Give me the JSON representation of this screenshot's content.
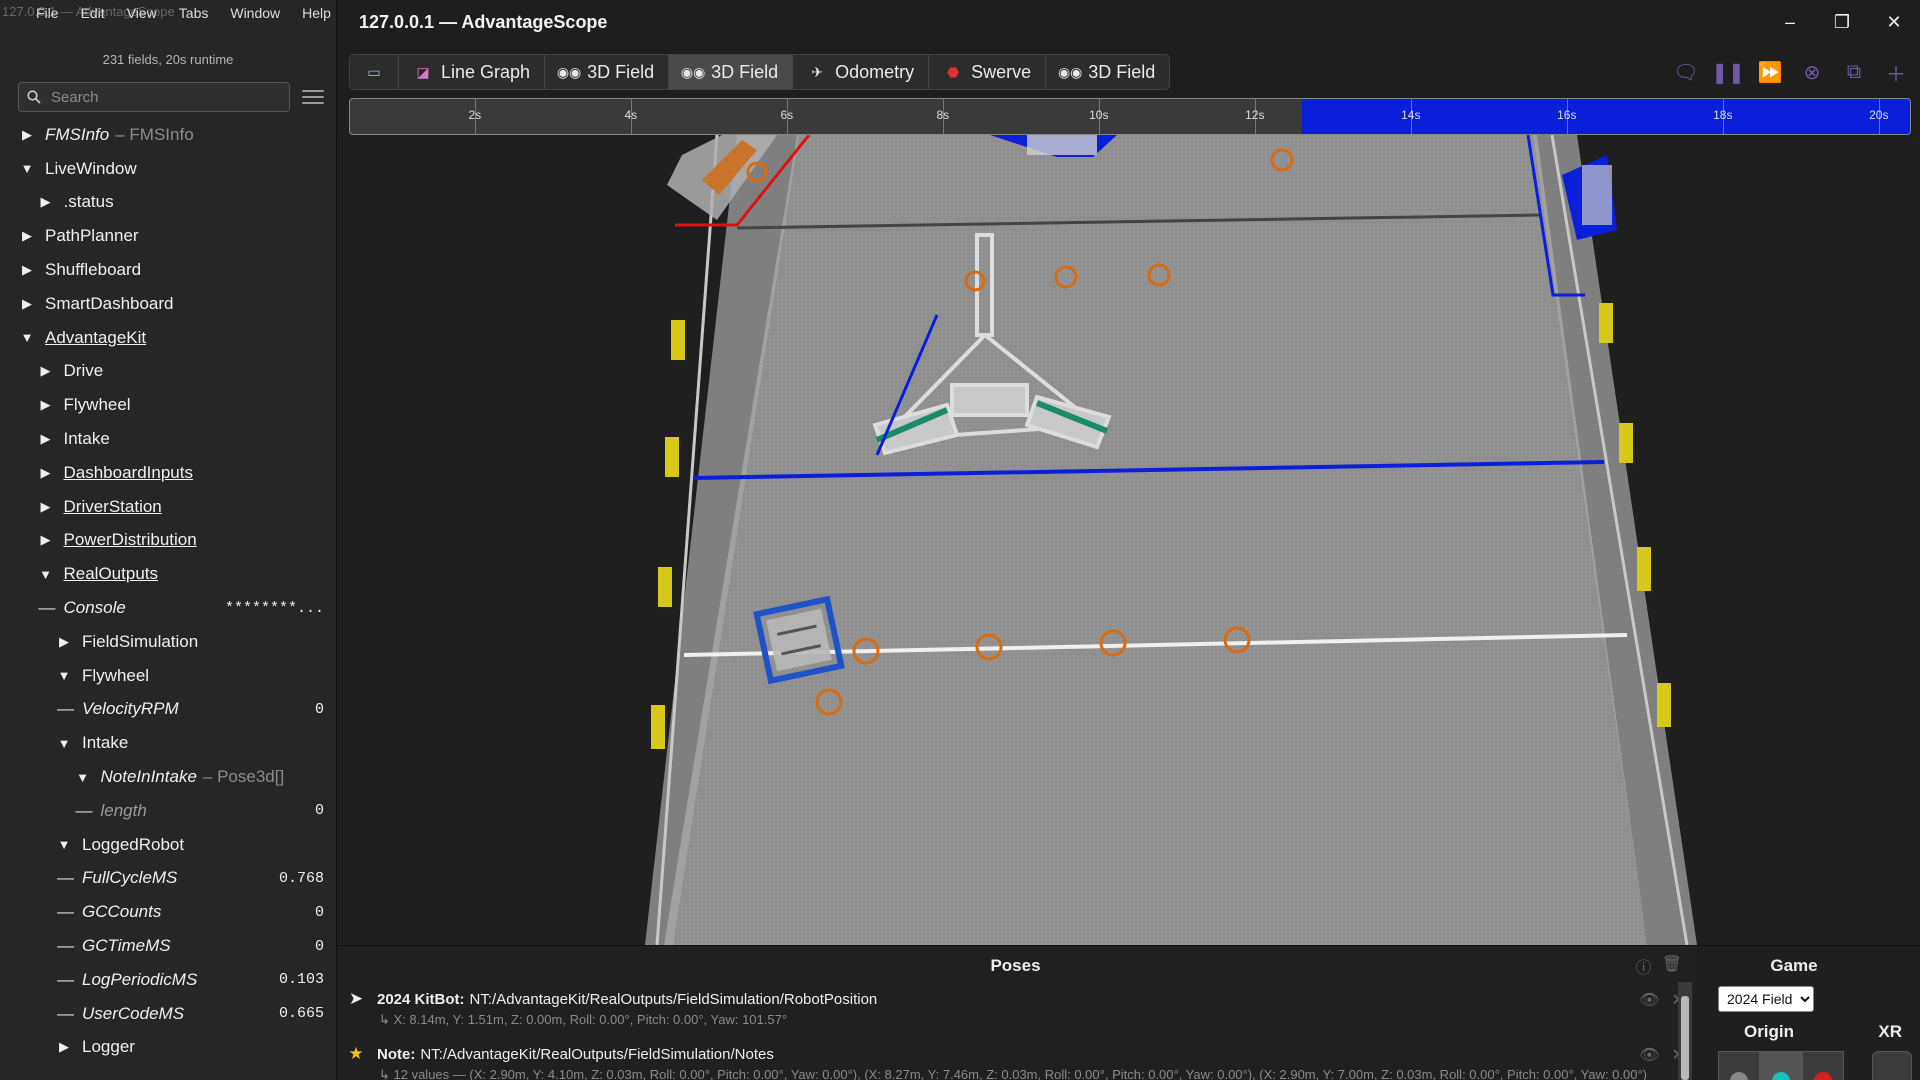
{
  "app": {
    "window_title": "127.0.0.1 — AdvantageScope",
    "ghost_title": "127.0.0.1 — AdvantageScope",
    "menu": [
      "File",
      "Edit",
      "View",
      "Tabs",
      "Window",
      "Help"
    ]
  },
  "sidebar": {
    "fields_info": "231 fields, 20s runtime",
    "search_placeholder": "Search",
    "tree": [
      {
        "indent": 0,
        "toggle": "collapsed",
        "label": "FMSInfo",
        "italic": true,
        "underline": false,
        "type": "– FMSInfo",
        "value": ""
      },
      {
        "indent": 0,
        "toggle": "expanded",
        "label": "LiveWindow",
        "italic": false,
        "underline": false,
        "type": "",
        "value": ""
      },
      {
        "indent": 1,
        "toggle": "collapsed",
        "label": ".status",
        "italic": false,
        "underline": false,
        "type": "",
        "value": ""
      },
      {
        "indent": 0,
        "toggle": "collapsed",
        "label": "PathPlanner",
        "italic": false,
        "underline": false,
        "type": "",
        "value": ""
      },
      {
        "indent": 0,
        "toggle": "collapsed",
        "label": "Shuffleboard",
        "italic": false,
        "underline": false,
        "type": "",
        "value": ""
      },
      {
        "indent": 0,
        "toggle": "collapsed",
        "label": "SmartDashboard",
        "italic": false,
        "underline": false,
        "type": "",
        "value": ""
      },
      {
        "indent": 0,
        "toggle": "expanded",
        "label": "AdvantageKit",
        "italic": false,
        "underline": true,
        "type": "",
        "value": ""
      },
      {
        "indent": 1,
        "toggle": "collapsed",
        "label": "Drive",
        "italic": false,
        "underline": false,
        "type": "",
        "value": ""
      },
      {
        "indent": 1,
        "toggle": "collapsed",
        "label": "Flywheel",
        "italic": false,
        "underline": false,
        "type": "",
        "value": ""
      },
      {
        "indent": 1,
        "toggle": "collapsed",
        "label": "Intake",
        "italic": false,
        "underline": false,
        "type": "",
        "value": ""
      },
      {
        "indent": 1,
        "toggle": "collapsed",
        "label": "DashboardInputs",
        "italic": false,
        "underline": true,
        "type": "",
        "value": ""
      },
      {
        "indent": 1,
        "toggle": "collapsed",
        "label": "DriverStation",
        "italic": false,
        "underline": true,
        "type": "",
        "value": ""
      },
      {
        "indent": 1,
        "toggle": "collapsed",
        "label": "PowerDistribution",
        "italic": false,
        "underline": true,
        "type": "",
        "value": ""
      },
      {
        "indent": 1,
        "toggle": "expanded",
        "label": "RealOutputs",
        "italic": false,
        "underline": true,
        "type": "",
        "value": ""
      },
      {
        "indent": 1,
        "toggle": "leaf",
        "label": "Console",
        "italic": true,
        "underline": false,
        "type": "",
        "value": "********..."
      },
      {
        "indent": 2,
        "toggle": "collapsed",
        "label": "FieldSimulation",
        "italic": false,
        "underline": false,
        "type": "",
        "value": ""
      },
      {
        "indent": 2,
        "toggle": "expanded",
        "label": "Flywheel",
        "italic": false,
        "underline": false,
        "type": "",
        "value": ""
      },
      {
        "indent": 2,
        "toggle": "leaf",
        "label": "VelocityRPM",
        "italic": true,
        "underline": false,
        "type": "",
        "value": "0"
      },
      {
        "indent": 2,
        "toggle": "expanded",
        "label": "Intake",
        "italic": false,
        "underline": false,
        "type": "",
        "value": ""
      },
      {
        "indent": 3,
        "toggle": "expanded",
        "label": "NoteInIntake",
        "italic": true,
        "underline": false,
        "type": "– Pose3d[]",
        "value": ""
      },
      {
        "indent": 3,
        "toggle": "leaf",
        "label": "length",
        "italic": true,
        "underline": false,
        "type": "",
        "value": "0",
        "dim": true
      },
      {
        "indent": 2,
        "toggle": "expanded",
        "label": "LoggedRobot",
        "italic": false,
        "underline": false,
        "type": "",
        "value": ""
      },
      {
        "indent": 2,
        "toggle": "leaf",
        "label": "FullCycleMS",
        "italic": true,
        "underline": false,
        "type": "",
        "value": "0.768"
      },
      {
        "indent": 2,
        "toggle": "leaf",
        "label": "GCCounts",
        "italic": true,
        "underline": false,
        "type": "",
        "value": "0"
      },
      {
        "indent": 2,
        "toggle": "leaf",
        "label": "GCTimeMS",
        "italic": true,
        "underline": false,
        "type": "",
        "value": "0"
      },
      {
        "indent": 2,
        "toggle": "leaf",
        "label": "LogPeriodicMS",
        "italic": true,
        "underline": false,
        "type": "",
        "value": "0.103"
      },
      {
        "indent": 2,
        "toggle": "leaf",
        "label": "UserCodeMS",
        "italic": true,
        "underline": false,
        "type": "",
        "value": "0.665"
      },
      {
        "indent": 2,
        "toggle": "collapsed",
        "label": "Logger",
        "italic": false,
        "underline": false,
        "type": "",
        "value": ""
      }
    ]
  },
  "tabs": [
    {
      "label": "",
      "icon": "document-icon",
      "active": false
    },
    {
      "label": "Line Graph",
      "icon": "line-graph-icon",
      "active": false
    },
    {
      "label": "3D Field",
      "icon": "3d-field-icon",
      "active": false
    },
    {
      "label": "3D Field",
      "icon": "3d-field-icon",
      "active": true
    },
    {
      "label": "Odometry",
      "icon": "odometry-icon",
      "active": false
    },
    {
      "label": "Swerve",
      "icon": "swerve-icon",
      "active": false
    },
    {
      "label": "3D Field",
      "icon": "3d-field-icon",
      "active": false
    }
  ],
  "timeline": {
    "range": [
      0.4,
      20.4
    ],
    "ticks": [
      "2s",
      "4s",
      "6s",
      "8s",
      "10s",
      "12s",
      "14s",
      "16s",
      "18s",
      "20s"
    ],
    "tick_values": [
      2,
      4,
      6,
      8,
      10,
      12,
      14,
      16,
      18,
      20
    ],
    "selection_start": 12.6,
    "selection_end": 20.4,
    "selection_color": "#0a1fd9"
  },
  "poses": {
    "title": "Poses",
    "items": [
      {
        "icon": "navigation-arrow-icon",
        "name": "2024 KitBot:",
        "path": "NT:/AdvantageKit/RealOutputs/FieldSimulation/RobotPosition",
        "detail": "↳ X: 8.14m, Y: 1.51m, Z: 0.00m, Roll: 0.00°, Pitch: 0.00°, Yaw: 101.57°"
      },
      {
        "icon": "star-icon",
        "name": "Note:",
        "path": "NT:/AdvantageKit/RealOutputs/FieldSimulation/Notes",
        "detail": "↳ 12 values — (X: 2.90m, Y: 4.10m, Z: 0.03m, Roll: 0.00°, Pitch: 0.00°, Yaw: 0.00°), (X: 8.27m, Y: 7.46m, Z: 0.03m, Roll: 0.00°, Pitch: 0.00°, Yaw: 0.00°), (X: 2.90m, Y: 7.00m, Z: 0.03m, Roll: 0.00°, Pitch: 0.00°, Yaw: 0.00°)"
      }
    ]
  },
  "config": {
    "game_label": "Game",
    "game_selected": "2024 Field",
    "origin_label": "Origin",
    "xr_label": "XR",
    "origin_colors": [
      "#888888",
      "#18c0c0",
      "#d42020"
    ]
  },
  "colors": {
    "blue_alliance": "#0a1fd9",
    "red_alliance": "#e01010",
    "note": "#d86a10",
    "accent": "#6e5ba8"
  }
}
